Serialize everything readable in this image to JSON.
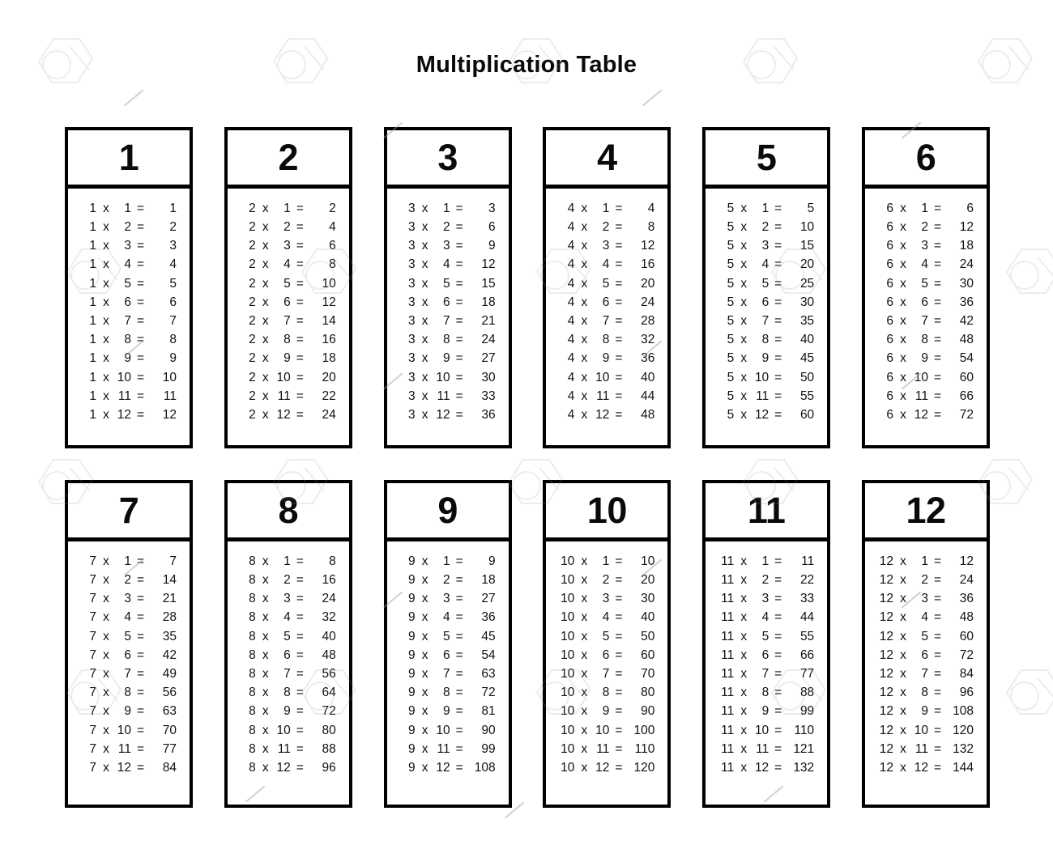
{
  "page": {
    "title": "Multiplication Table",
    "background_color": "#ffffff",
    "text_color": "#0a0a0a",
    "border_color": "#000000",
    "operator_symbol": "x",
    "equals_symbol": "="
  },
  "tables": [
    {
      "header": "1",
      "rows": [
        {
          "a": "1",
          "op": "x",
          "b": "1",
          "eq": "=",
          "result": "1"
        },
        {
          "a": "1",
          "op": "x",
          "b": "2",
          "eq": "=",
          "result": "2"
        },
        {
          "a": "1",
          "op": "x",
          "b": "3",
          "eq": "=",
          "result": "3"
        },
        {
          "a": "1",
          "op": "x",
          "b": "4",
          "eq": "=",
          "result": "4"
        },
        {
          "a": "1",
          "op": "x",
          "b": "5",
          "eq": "=",
          "result": "5"
        },
        {
          "a": "1",
          "op": "x",
          "b": "6",
          "eq": "=",
          "result": "6"
        },
        {
          "a": "1",
          "op": "x",
          "b": "7",
          "eq": "=",
          "result": "7"
        },
        {
          "a": "1",
          "op": "x",
          "b": "8",
          "eq": "=",
          "result": "8"
        },
        {
          "a": "1",
          "op": "x",
          "b": "9",
          "eq": "=",
          "result": "9"
        },
        {
          "a": "1",
          "op": "x",
          "b": "10",
          "eq": "=",
          "result": "10"
        },
        {
          "a": "1",
          "op": "x",
          "b": "11",
          "eq": "=",
          "result": "11"
        },
        {
          "a": "1",
          "op": "x",
          "b": "12",
          "eq": "=",
          "result": "12"
        }
      ]
    },
    {
      "header": "2",
      "rows": [
        {
          "a": "2",
          "op": "x",
          "b": "1",
          "eq": "=",
          "result": "2"
        },
        {
          "a": "2",
          "op": "x",
          "b": "2",
          "eq": "=",
          "result": "4"
        },
        {
          "a": "2",
          "op": "x",
          "b": "3",
          "eq": "=",
          "result": "6"
        },
        {
          "a": "2",
          "op": "x",
          "b": "4",
          "eq": "=",
          "result": "8"
        },
        {
          "a": "2",
          "op": "x",
          "b": "5",
          "eq": "=",
          "result": "10"
        },
        {
          "a": "2",
          "op": "x",
          "b": "6",
          "eq": "=",
          "result": "12"
        },
        {
          "a": "2",
          "op": "x",
          "b": "7",
          "eq": "=",
          "result": "14"
        },
        {
          "a": "2",
          "op": "x",
          "b": "8",
          "eq": "=",
          "result": "16"
        },
        {
          "a": "2",
          "op": "x",
          "b": "9",
          "eq": "=",
          "result": "18"
        },
        {
          "a": "2",
          "op": "x",
          "b": "10",
          "eq": "=",
          "result": "20"
        },
        {
          "a": "2",
          "op": "x",
          "b": "11",
          "eq": "=",
          "result": "22"
        },
        {
          "a": "2",
          "op": "x",
          "b": "12",
          "eq": "=",
          "result": "24"
        }
      ]
    },
    {
      "header": "3",
      "rows": [
        {
          "a": "3",
          "op": "x",
          "b": "1",
          "eq": "=",
          "result": "3"
        },
        {
          "a": "3",
          "op": "x",
          "b": "2",
          "eq": "=",
          "result": "6"
        },
        {
          "a": "3",
          "op": "x",
          "b": "3",
          "eq": "=",
          "result": "9"
        },
        {
          "a": "3",
          "op": "x",
          "b": "4",
          "eq": "=",
          "result": "12"
        },
        {
          "a": "3",
          "op": "x",
          "b": "5",
          "eq": "=",
          "result": "15"
        },
        {
          "a": "3",
          "op": "x",
          "b": "6",
          "eq": "=",
          "result": "18"
        },
        {
          "a": "3",
          "op": "x",
          "b": "7",
          "eq": "=",
          "result": "21"
        },
        {
          "a": "3",
          "op": "x",
          "b": "8",
          "eq": "=",
          "result": "24"
        },
        {
          "a": "3",
          "op": "x",
          "b": "9",
          "eq": "=",
          "result": "27"
        },
        {
          "a": "3",
          "op": "x",
          "b": "10",
          "eq": "=",
          "result": "30"
        },
        {
          "a": "3",
          "op": "x",
          "b": "11",
          "eq": "=",
          "result": "33"
        },
        {
          "a": "3",
          "op": "x",
          "b": "12",
          "eq": "=",
          "result": "36"
        }
      ]
    },
    {
      "header": "4",
      "rows": [
        {
          "a": "4",
          "op": "x",
          "b": "1",
          "eq": "=",
          "result": "4"
        },
        {
          "a": "4",
          "op": "x",
          "b": "2",
          "eq": "=",
          "result": "8"
        },
        {
          "a": "4",
          "op": "x",
          "b": "3",
          "eq": "=",
          "result": "12"
        },
        {
          "a": "4",
          "op": "x",
          "b": "4",
          "eq": "=",
          "result": "16"
        },
        {
          "a": "4",
          "op": "x",
          "b": "5",
          "eq": "=",
          "result": "20"
        },
        {
          "a": "4",
          "op": "x",
          "b": "6",
          "eq": "=",
          "result": "24"
        },
        {
          "a": "4",
          "op": "x",
          "b": "7",
          "eq": "=",
          "result": "28"
        },
        {
          "a": "4",
          "op": "x",
          "b": "8",
          "eq": "=",
          "result": "32"
        },
        {
          "a": "4",
          "op": "x",
          "b": "9",
          "eq": "=",
          "result": "36"
        },
        {
          "a": "4",
          "op": "x",
          "b": "10",
          "eq": "=",
          "result": "40"
        },
        {
          "a": "4",
          "op": "x",
          "b": "11",
          "eq": "=",
          "result": "44"
        },
        {
          "a": "4",
          "op": "x",
          "b": "12",
          "eq": "=",
          "result": "48"
        }
      ]
    },
    {
      "header": "5",
      "rows": [
        {
          "a": "5",
          "op": "x",
          "b": "1",
          "eq": "=",
          "result": "5"
        },
        {
          "a": "5",
          "op": "x",
          "b": "2",
          "eq": "=",
          "result": "10"
        },
        {
          "a": "5",
          "op": "x",
          "b": "3",
          "eq": "=",
          "result": "15"
        },
        {
          "a": "5",
          "op": "x",
          "b": "4",
          "eq": "=",
          "result": "20"
        },
        {
          "a": "5",
          "op": "x",
          "b": "5",
          "eq": "=",
          "result": "25"
        },
        {
          "a": "5",
          "op": "x",
          "b": "6",
          "eq": "=",
          "result": "30"
        },
        {
          "a": "5",
          "op": "x",
          "b": "7",
          "eq": "=",
          "result": "35"
        },
        {
          "a": "5",
          "op": "x",
          "b": "8",
          "eq": "=",
          "result": "40"
        },
        {
          "a": "5",
          "op": "x",
          "b": "9",
          "eq": "=",
          "result": "45"
        },
        {
          "a": "5",
          "op": "x",
          "b": "10",
          "eq": "=",
          "result": "50"
        },
        {
          "a": "5",
          "op": "x",
          "b": "11",
          "eq": "=",
          "result": "55"
        },
        {
          "a": "5",
          "op": "x",
          "b": "12",
          "eq": "=",
          "result": "60"
        }
      ]
    },
    {
      "header": "6",
      "rows": [
        {
          "a": "6",
          "op": "x",
          "b": "1",
          "eq": "=",
          "result": "6"
        },
        {
          "a": "6",
          "op": "x",
          "b": "2",
          "eq": "=",
          "result": "12"
        },
        {
          "a": "6",
          "op": "x",
          "b": "3",
          "eq": "=",
          "result": "18"
        },
        {
          "a": "6",
          "op": "x",
          "b": "4",
          "eq": "=",
          "result": "24"
        },
        {
          "a": "6",
          "op": "x",
          "b": "5",
          "eq": "=",
          "result": "30"
        },
        {
          "a": "6",
          "op": "x",
          "b": "6",
          "eq": "=",
          "result": "36"
        },
        {
          "a": "6",
          "op": "x",
          "b": "7",
          "eq": "=",
          "result": "42"
        },
        {
          "a": "6",
          "op": "x",
          "b": "8",
          "eq": "=",
          "result": "48"
        },
        {
          "a": "6",
          "op": "x",
          "b": "9",
          "eq": "=",
          "result": "54"
        },
        {
          "a": "6",
          "op": "x",
          "b": "10",
          "eq": "=",
          "result": "60"
        },
        {
          "a": "6",
          "op": "x",
          "b": "11",
          "eq": "=",
          "result": "66"
        },
        {
          "a": "6",
          "op": "x",
          "b": "12",
          "eq": "=",
          "result": "72"
        }
      ]
    },
    {
      "header": "7",
      "rows": [
        {
          "a": "7",
          "op": "x",
          "b": "1",
          "eq": "=",
          "result": "7"
        },
        {
          "a": "7",
          "op": "x",
          "b": "2",
          "eq": "=",
          "result": "14"
        },
        {
          "a": "7",
          "op": "x",
          "b": "3",
          "eq": "=",
          "result": "21"
        },
        {
          "a": "7",
          "op": "x",
          "b": "4",
          "eq": "=",
          "result": "28"
        },
        {
          "a": "7",
          "op": "x",
          "b": "5",
          "eq": "=",
          "result": "35"
        },
        {
          "a": "7",
          "op": "x",
          "b": "6",
          "eq": "=",
          "result": "42"
        },
        {
          "a": "7",
          "op": "x",
          "b": "7",
          "eq": "=",
          "result": "49"
        },
        {
          "a": "7",
          "op": "x",
          "b": "8",
          "eq": "=",
          "result": "56"
        },
        {
          "a": "7",
          "op": "x",
          "b": "9",
          "eq": "=",
          "result": "63"
        },
        {
          "a": "7",
          "op": "x",
          "b": "10",
          "eq": "=",
          "result": "70"
        },
        {
          "a": "7",
          "op": "x",
          "b": "11",
          "eq": "=",
          "result": "77"
        },
        {
          "a": "7",
          "op": "x",
          "b": "12",
          "eq": "=",
          "result": "84"
        }
      ]
    },
    {
      "header": "8",
      "rows": [
        {
          "a": "8",
          "op": "x",
          "b": "1",
          "eq": "=",
          "result": "8"
        },
        {
          "a": "8",
          "op": "x",
          "b": "2",
          "eq": "=",
          "result": "16"
        },
        {
          "a": "8",
          "op": "x",
          "b": "3",
          "eq": "=",
          "result": "24"
        },
        {
          "a": "8",
          "op": "x",
          "b": "4",
          "eq": "=",
          "result": "32"
        },
        {
          "a": "8",
          "op": "x",
          "b": "5",
          "eq": "=",
          "result": "40"
        },
        {
          "a": "8",
          "op": "x",
          "b": "6",
          "eq": "=",
          "result": "48"
        },
        {
          "a": "8",
          "op": "x",
          "b": "7",
          "eq": "=",
          "result": "56"
        },
        {
          "a": "8",
          "op": "x",
          "b": "8",
          "eq": "=",
          "result": "64"
        },
        {
          "a": "8",
          "op": "x",
          "b": "9",
          "eq": "=",
          "result": "72"
        },
        {
          "a": "8",
          "op": "x",
          "b": "10",
          "eq": "=",
          "result": "80"
        },
        {
          "a": "8",
          "op": "x",
          "b": "11",
          "eq": "=",
          "result": "88"
        },
        {
          "a": "8",
          "op": "x",
          "b": "12",
          "eq": "=",
          "result": "96"
        }
      ]
    },
    {
      "header": "9",
      "rows": [
        {
          "a": "9",
          "op": "x",
          "b": "1",
          "eq": "=",
          "result": "9"
        },
        {
          "a": "9",
          "op": "x",
          "b": "2",
          "eq": "=",
          "result": "18"
        },
        {
          "a": "9",
          "op": "x",
          "b": "3",
          "eq": "=",
          "result": "27"
        },
        {
          "a": "9",
          "op": "x",
          "b": "4",
          "eq": "=",
          "result": "36"
        },
        {
          "a": "9",
          "op": "x",
          "b": "5",
          "eq": "=",
          "result": "45"
        },
        {
          "a": "9",
          "op": "x",
          "b": "6",
          "eq": "=",
          "result": "54"
        },
        {
          "a": "9",
          "op": "x",
          "b": "7",
          "eq": "=",
          "result": "63"
        },
        {
          "a": "9",
          "op": "x",
          "b": "8",
          "eq": "=",
          "result": "72"
        },
        {
          "a": "9",
          "op": "x",
          "b": "9",
          "eq": "=",
          "result": "81"
        },
        {
          "a": "9",
          "op": "x",
          "b": "10",
          "eq": "=",
          "result": "90"
        },
        {
          "a": "9",
          "op": "x",
          "b": "11",
          "eq": "=",
          "result": "99"
        },
        {
          "a": "9",
          "op": "x",
          "b": "12",
          "eq": "=",
          "result": "108"
        }
      ]
    },
    {
      "header": "10",
      "rows": [
        {
          "a": "10",
          "op": "x",
          "b": "1",
          "eq": "=",
          "result": "10"
        },
        {
          "a": "10",
          "op": "x",
          "b": "2",
          "eq": "=",
          "result": "20"
        },
        {
          "a": "10",
          "op": "x",
          "b": "3",
          "eq": "=",
          "result": "30"
        },
        {
          "a": "10",
          "op": "x",
          "b": "4",
          "eq": "=",
          "result": "40"
        },
        {
          "a": "10",
          "op": "x",
          "b": "5",
          "eq": "=",
          "result": "50"
        },
        {
          "a": "10",
          "op": "x",
          "b": "6",
          "eq": "=",
          "result": "60"
        },
        {
          "a": "10",
          "op": "x",
          "b": "7",
          "eq": "=",
          "result": "70"
        },
        {
          "a": "10",
          "op": "x",
          "b": "8",
          "eq": "=",
          "result": "80"
        },
        {
          "a": "10",
          "op": "x",
          "b": "9",
          "eq": "=",
          "result": "90"
        },
        {
          "a": "10",
          "op": "x",
          "b": "10",
          "eq": "=",
          "result": "100"
        },
        {
          "a": "10",
          "op": "x",
          "b": "11",
          "eq": "=",
          "result": "110"
        },
        {
          "a": "10",
          "op": "x",
          "b": "12",
          "eq": "=",
          "result": "120"
        }
      ]
    },
    {
      "header": "11",
      "rows": [
        {
          "a": "11",
          "op": "x",
          "b": "1",
          "eq": "=",
          "result": "11"
        },
        {
          "a": "11",
          "op": "x",
          "b": "2",
          "eq": "=",
          "result": "22"
        },
        {
          "a": "11",
          "op": "x",
          "b": "3",
          "eq": "=",
          "result": "33"
        },
        {
          "a": "11",
          "op": "x",
          "b": "4",
          "eq": "=",
          "result": "44"
        },
        {
          "a": "11",
          "op": "x",
          "b": "5",
          "eq": "=",
          "result": "55"
        },
        {
          "a": "11",
          "op": "x",
          "b": "6",
          "eq": "=",
          "result": "66"
        },
        {
          "a": "11",
          "op": "x",
          "b": "7",
          "eq": "=",
          "result": "77"
        },
        {
          "a": "11",
          "op": "x",
          "b": "8",
          "eq": "=",
          "result": "88"
        },
        {
          "a": "11",
          "op": "x",
          "b": "9",
          "eq": "=",
          "result": "99"
        },
        {
          "a": "11",
          "op": "x",
          "b": "10",
          "eq": "=",
          "result": "110"
        },
        {
          "a": "11",
          "op": "x",
          "b": "11",
          "eq": "=",
          "result": "121"
        },
        {
          "a": "11",
          "op": "x",
          "b": "12",
          "eq": "=",
          "result": "132"
        }
      ]
    },
    {
      "header": "12",
      "rows": [
        {
          "a": "12",
          "op": "x",
          "b": "1",
          "eq": "=",
          "result": "12"
        },
        {
          "a": "12",
          "op": "x",
          "b": "2",
          "eq": "=",
          "result": "24"
        },
        {
          "a": "12",
          "op": "x",
          "b": "3",
          "eq": "=",
          "result": "36"
        },
        {
          "a": "12",
          "op": "x",
          "b": "4",
          "eq": "=",
          "result": "48"
        },
        {
          "a": "12",
          "op": "x",
          "b": "5",
          "eq": "=",
          "result": "60"
        },
        {
          "a": "12",
          "op": "x",
          "b": "6",
          "eq": "=",
          "result": "72"
        },
        {
          "a": "12",
          "op": "x",
          "b": "7",
          "eq": "=",
          "result": "84"
        },
        {
          "a": "12",
          "op": "x",
          "b": "8",
          "eq": "=",
          "result": "96"
        },
        {
          "a": "12",
          "op": "x",
          "b": "9",
          "eq": "=",
          "result": "108"
        },
        {
          "a": "12",
          "op": "x",
          "b": "10",
          "eq": "=",
          "result": "120"
        },
        {
          "a": "12",
          "op": "x",
          "b": "11",
          "eq": "=",
          "result": "132"
        },
        {
          "a": "12",
          "op": "x",
          "b": "12",
          "eq": "=",
          "result": "144"
        }
      ]
    }
  ]
}
